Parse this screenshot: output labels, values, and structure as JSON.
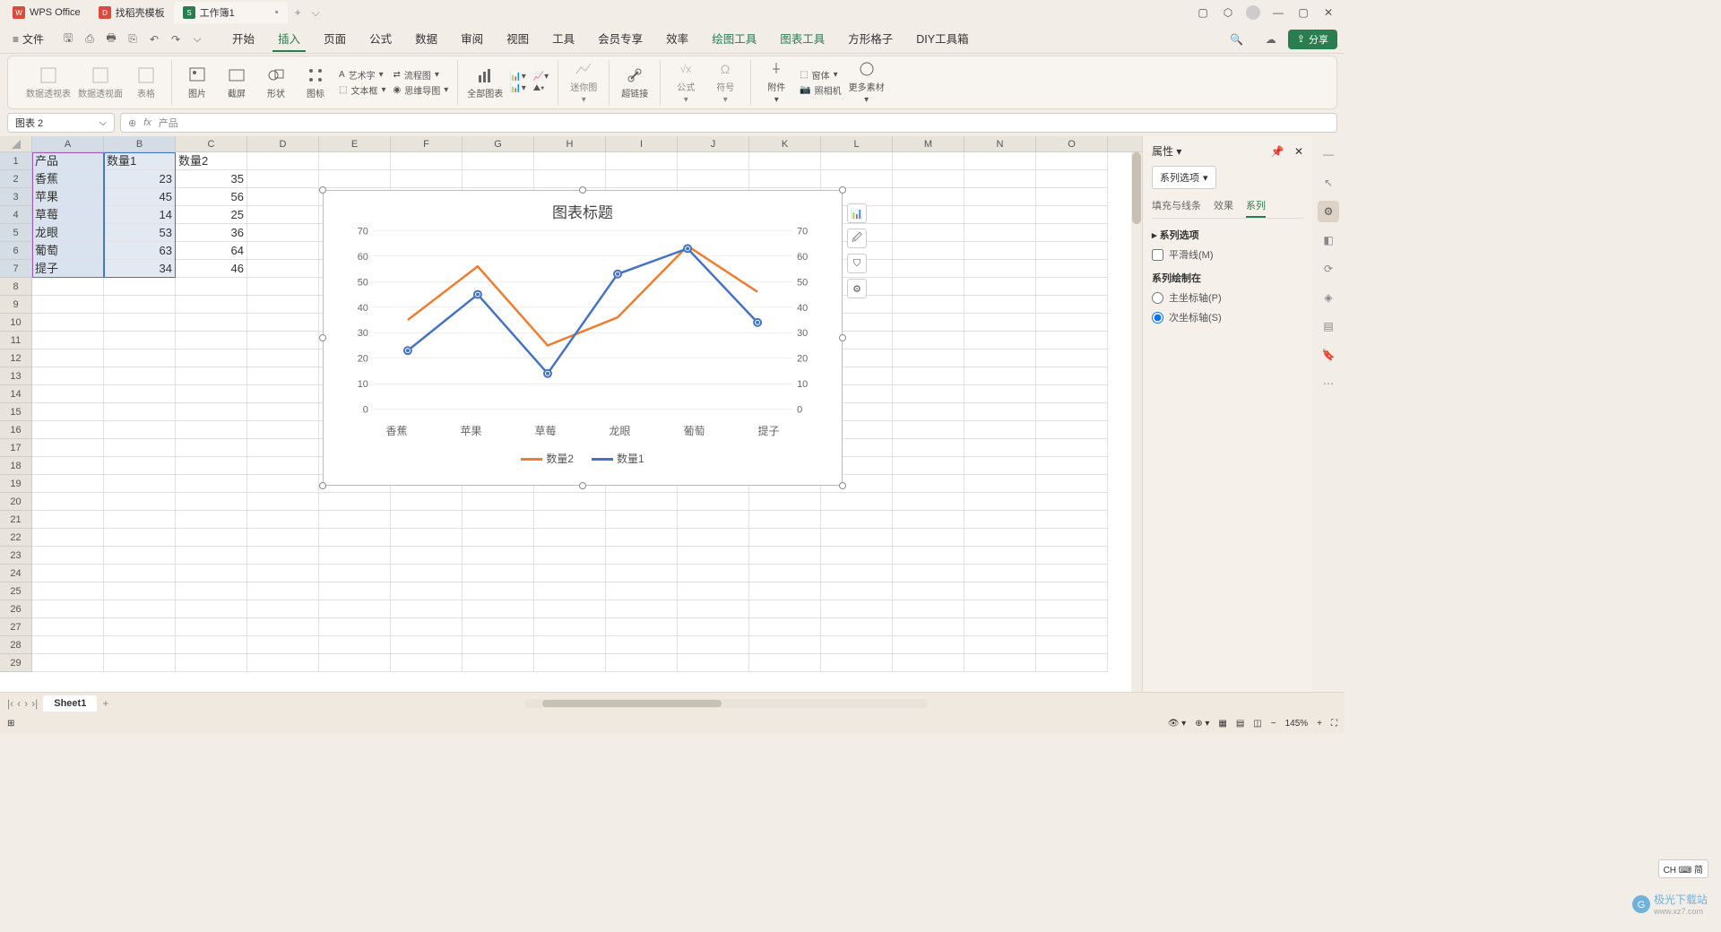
{
  "title_tabs": [
    {
      "icon": "wps",
      "label": "WPS Office",
      "color": "#d94b3f"
    },
    {
      "icon": "doc",
      "label": "找稻壳模板",
      "color": "#d94b3f"
    },
    {
      "icon": "sheet",
      "label": "工作簿1",
      "color": "#2a7d4f",
      "active": true,
      "dirty": "•"
    }
  ],
  "file_label": "文件",
  "menu_tabs": [
    "开始",
    "插入",
    "页面",
    "公式",
    "数据",
    "审阅",
    "视图",
    "工具",
    "会员专享",
    "效率",
    "绘图工具",
    "图表工具",
    "方形格子",
    "DIY工具箱"
  ],
  "menu_active": "插入",
  "menu_green": [
    "绘图工具",
    "图表工具"
  ],
  "share_label": "分享",
  "ribbon": {
    "g1": [
      "数据透视表",
      "数据透视面",
      "表格"
    ],
    "g2": [
      "图片",
      "截屏",
      "形状",
      "图标"
    ],
    "art": "艺术字",
    "flow": "流程图",
    "textbox": "文本框",
    "mind": "思维导图",
    "g3": [
      "全部图表"
    ],
    "mini": "迷你图",
    "link": "超链接",
    "formula": "公式",
    "symbol": "符号",
    "attach": "附件",
    "camera": "照相机",
    "cube": "窗体",
    "more": "更多素材"
  },
  "name_box": "图表 2",
  "formula": "产品",
  "columns": [
    "A",
    "B",
    "C",
    "D",
    "E",
    "F",
    "G",
    "H",
    "I",
    "J",
    "K",
    "L",
    "M",
    "N",
    "O"
  ],
  "rows_count": 29,
  "data_rows": [
    [
      "产品",
      "数量1",
      "数量2"
    ],
    [
      "香蕉",
      "23",
      "35"
    ],
    [
      "苹果",
      "45",
      "56"
    ],
    [
      "草莓",
      "14",
      "25"
    ],
    [
      "龙眼",
      "53",
      "36"
    ],
    [
      "葡萄",
      "63",
      "64"
    ],
    [
      "提子",
      "34",
      "46"
    ]
  ],
  "chart": {
    "title": "图表标题",
    "legend1": "数量2",
    "legend2": "数量1",
    "color1": "#ed7d31",
    "color2": "#4472c4"
  },
  "chart_data": {
    "type": "line",
    "title": "图表标题",
    "categories": [
      "香蕉",
      "苹果",
      "草莓",
      "龙眼",
      "葡萄",
      "提子"
    ],
    "series": [
      {
        "name": "数量2",
        "values": [
          35,
          56,
          25,
          36,
          64,
          46
        ],
        "color": "#ed7d31",
        "axis": "primary"
      },
      {
        "name": "数量1",
        "values": [
          23,
          45,
          14,
          53,
          63,
          34
        ],
        "color": "#4472c4",
        "axis": "secondary"
      }
    ],
    "ylabel": "",
    "xlabel": "",
    "ylim_left": [
      0,
      70
    ],
    "ylim_right": [
      0,
      70
    ],
    "yticks": [
      0,
      10,
      20,
      30,
      40,
      50,
      60,
      70
    ]
  },
  "properties": {
    "title": "属性",
    "dropdown": "系列选项",
    "tabs": [
      "填充与线条",
      "效果",
      "系列"
    ],
    "tab_active": "系列",
    "section1": "系列选项",
    "smooth": "平滑线(M)",
    "section2": "系列绘制在",
    "primary": "主坐标轴(P)",
    "secondary": "次坐标轴(S)"
  },
  "sheet_tab": "Sheet1",
  "zoom": "145%",
  "ime": "CH ⌨ 简",
  "watermark": "极光下载站",
  "watermark_url": "www.xz7.com"
}
